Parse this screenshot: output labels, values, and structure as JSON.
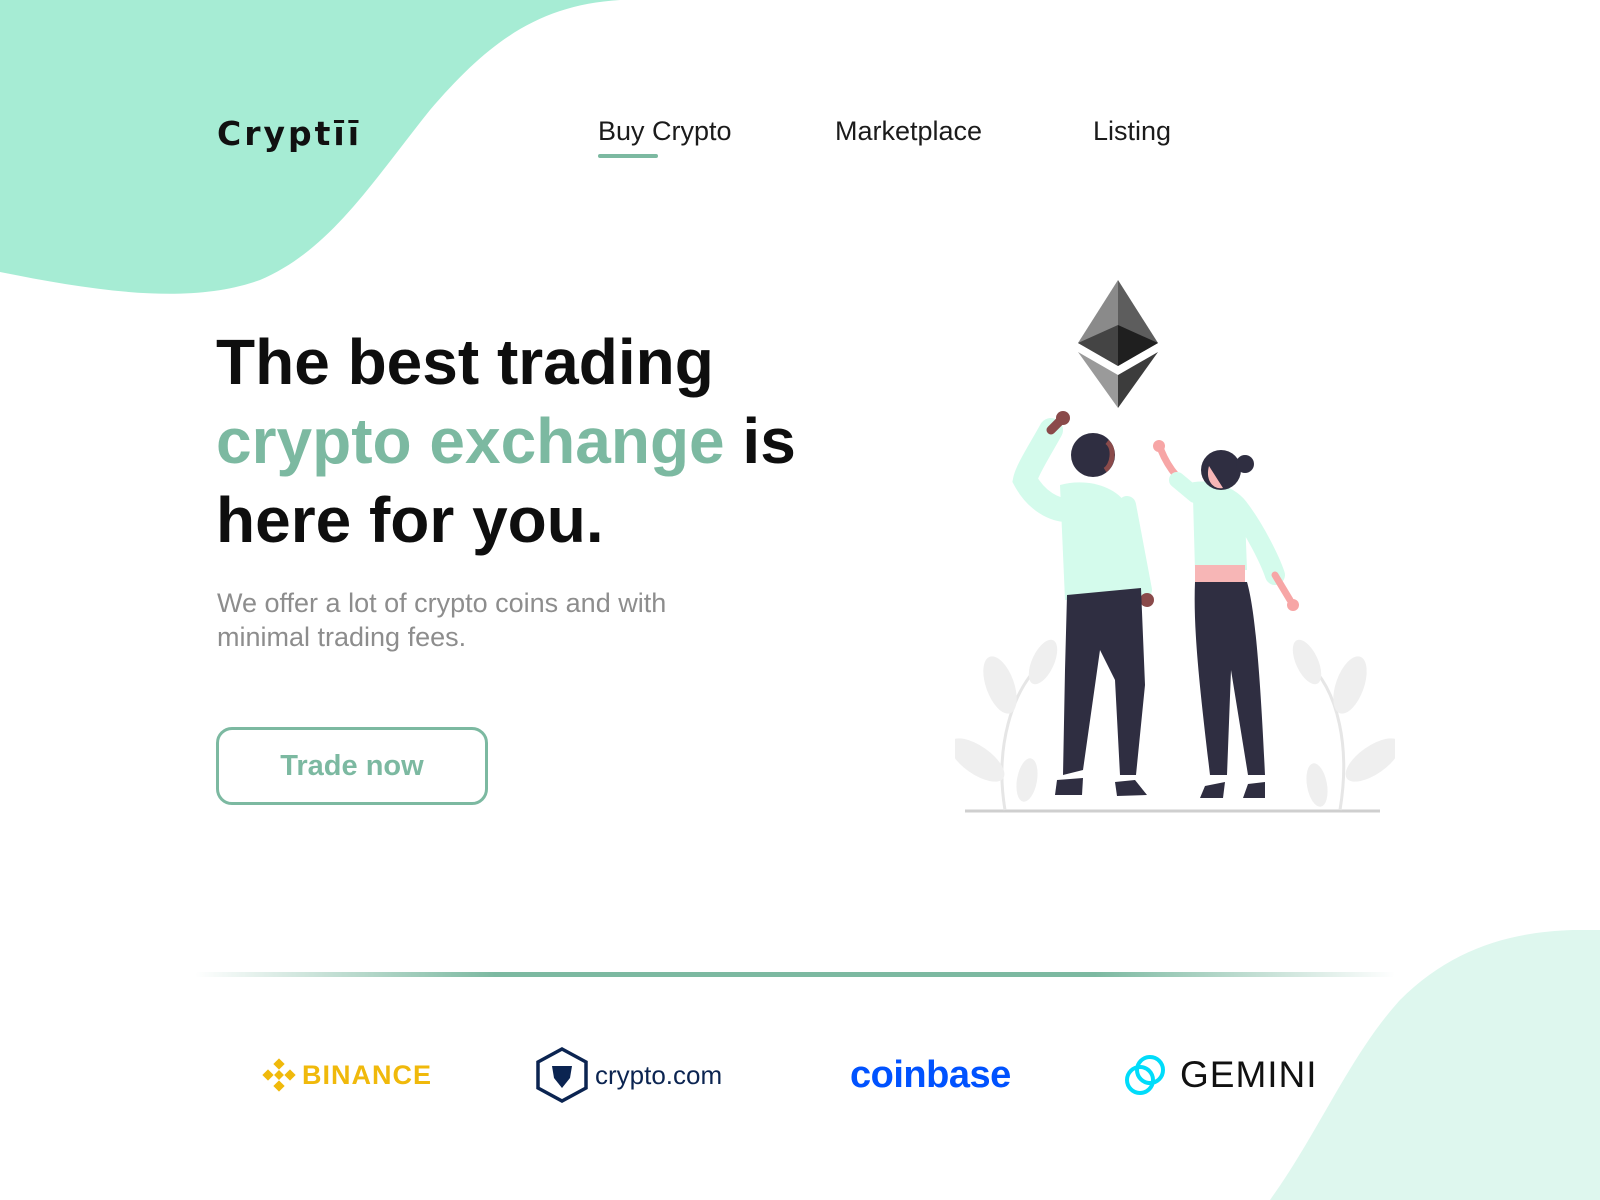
{
  "brand": {
    "name": "Cryptīī"
  },
  "nav": {
    "items": [
      {
        "label": "Buy Crypto",
        "active": true
      },
      {
        "label": "Marketplace",
        "active": false
      },
      {
        "label": "Listing",
        "active": false
      }
    ]
  },
  "hero": {
    "headline_part1": "The best trading",
    "headline_accent": "crypto exchange",
    "headline_part2": " is",
    "headline_part3": "here for you.",
    "subtitle": "We offer a lot of crypto coins and with minimal trading fees.",
    "cta_label": "Trade now"
  },
  "partners": [
    {
      "name": "BINANCE",
      "icon": "binance-diamond-icon"
    },
    {
      "name": "crypto.com",
      "icon": "cryptocom-shield-icon"
    },
    {
      "name": "coinbase",
      "icon": ""
    },
    {
      "name": "GEMINI",
      "icon": "gemini-icon"
    }
  ],
  "colors": {
    "accent": "#7cb9a1",
    "blob": "#a6ecd4",
    "binance": "#f0b90b",
    "cryptocom": "#0b2451",
    "coinbase": "#0052ff",
    "gemini_icon": "#00dcfa"
  },
  "illustration": {
    "icon": "ethereum-icon",
    "subject": "two-people-cheering"
  }
}
